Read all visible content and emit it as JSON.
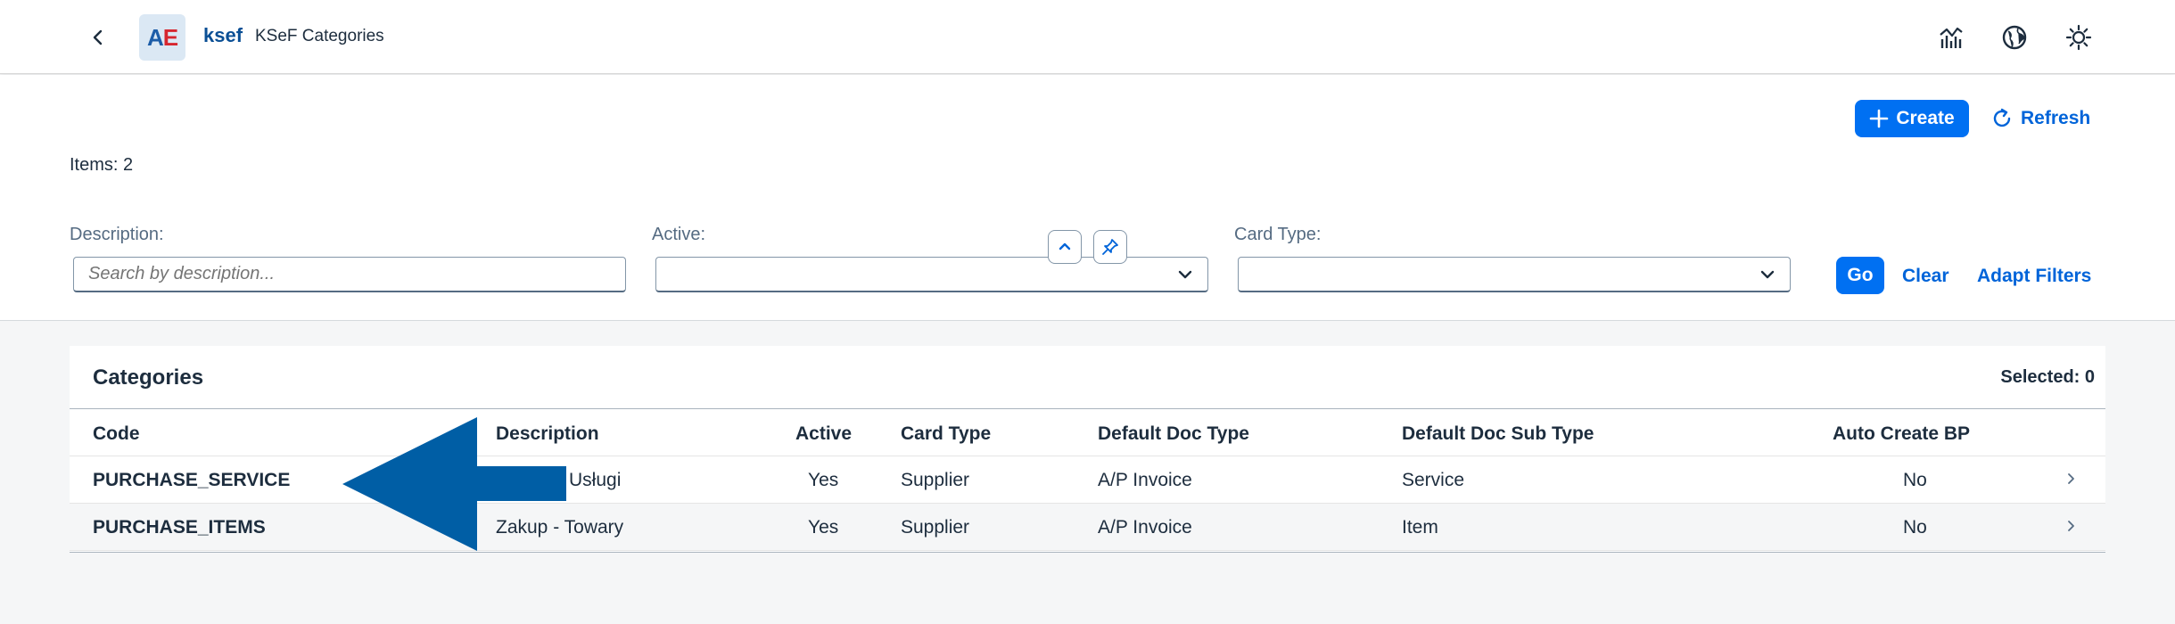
{
  "shell": {
    "logo_a": "A",
    "logo_e": "E",
    "app_name": "ksef",
    "page_title": "KSeF Categories",
    "icons": [
      "back-icon",
      "analytics-icon",
      "globe-icon",
      "theme-sun-icon"
    ]
  },
  "header": {
    "create_label": "Create",
    "refresh_label": "Refresh",
    "items_count": "Items: 2"
  },
  "filters": {
    "description_label": "Description:",
    "description_placeholder": "Search by description...",
    "description_value": "",
    "active_label": "Active:",
    "active_value": "",
    "card_type_label": "Card Type:",
    "card_type_value": "",
    "go_label": "Go",
    "clear_label": "Clear",
    "adapt_label": "Adapt Filters"
  },
  "table": {
    "title": "Categories",
    "selected": "Selected: 0",
    "columns": [
      "Code",
      "Description",
      "Active",
      "Card Type",
      "Default Doc Type",
      "Default Doc Sub Type",
      "Auto Create BP"
    ],
    "rows": [
      {
        "code": "PURCHASE_SERVICE",
        "description": "Usługi",
        "active": "Yes",
        "card_type": "Supplier",
        "doc_type": "A/P Invoice",
        "doc_sub_type": "Service",
        "auto_bp": "No"
      },
      {
        "code": "PURCHASE_ITEMS",
        "description": "Zakup - Towary",
        "active": "Yes",
        "card_type": "Supplier",
        "doc_type": "A/P Invoice",
        "doc_sub_type": "Item",
        "auto_bp": "No"
      }
    ]
  },
  "colors": {
    "brand": "#0070f2",
    "link": "#0064d9",
    "annotation_arrow": "#005ea5"
  }
}
